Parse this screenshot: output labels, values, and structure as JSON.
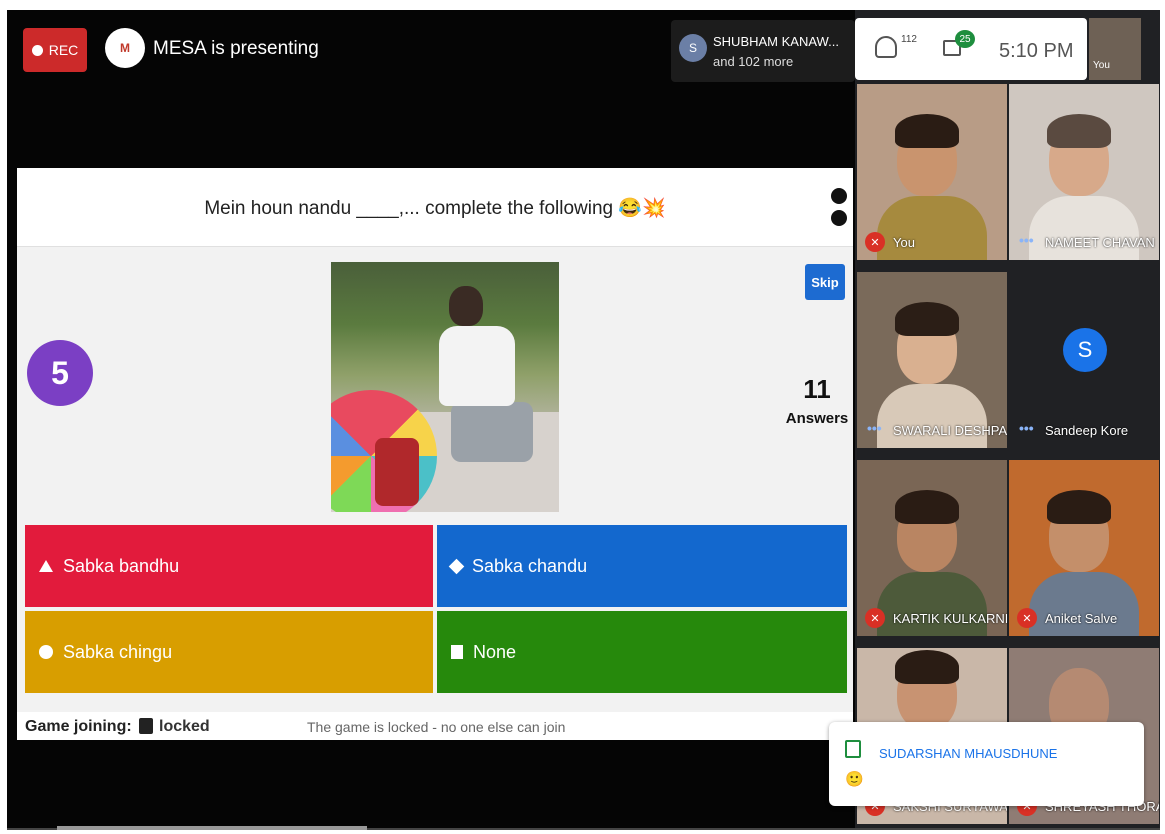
{
  "topbar": {
    "rec_label": "REC",
    "presenting": "MESA is presenting",
    "viewer_name": "SHUBHAM KANAW...",
    "viewer_more": "and 102 more"
  },
  "status": {
    "people_count": "112",
    "chat_count": "25",
    "time": "5:10 PM",
    "self_label": "You"
  },
  "game": {
    "question": "Mein houn nandu ____,... complete the following 😂💥",
    "skip_label": "Skip",
    "timer": "5",
    "answers_count": "11",
    "answers_label": "Answers",
    "options": [
      {
        "label": "Sabka bandhu",
        "color": "#e21b3c"
      },
      {
        "label": "Sabka chandu",
        "color": "#1368ce"
      },
      {
        "label": "Sabka chingu",
        "color": "#d89e00"
      },
      {
        "label": "None",
        "color": "#26890c"
      }
    ],
    "join_label": "Game joining:",
    "locked_label": "locked",
    "locked_note": "The game is locked - no one else can join"
  },
  "participants": [
    {
      "name": "You"
    },
    {
      "name": "NAMEET CHAVAN"
    },
    {
      "name": "SWARALI DESHPA..."
    },
    {
      "name": "Sandeep Kore",
      "initial": "S"
    },
    {
      "name": "KARTIK KULKARNI"
    },
    {
      "name": "Aniket Salve"
    },
    {
      "name": "SAKSHI SURYAWA..."
    },
    {
      "name": "SHREYASH THORAT"
    }
  ],
  "chat_popup": {
    "name": "SUDARSHAN MHAUSDHUNE",
    "message": "🙂"
  }
}
